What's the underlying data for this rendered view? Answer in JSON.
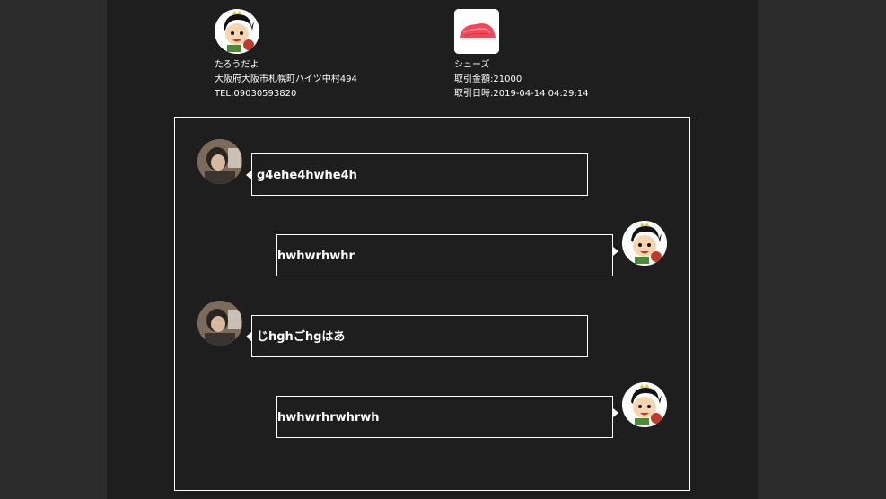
{
  "seller": {
    "name": "たろうだよ",
    "address": "大阪府大阪市札幌町ハイツ中村494",
    "tel": "TEL:09030593820",
    "avatar_icon": "cartoon-boy-avatar-icon"
  },
  "product": {
    "name": "シューズ",
    "price": "取引金額:21000",
    "datetime": "取引日時:2019-04-14 04:29:14",
    "image_icon": "red-shoes-image-icon"
  },
  "messages": [
    {
      "side": "left",
      "text": "g4ehe4hwhe4h",
      "avatar": "photo-avatar-icon"
    },
    {
      "side": "right",
      "text": "hwhwrhwhr",
      "avatar": "cartoon-boy-avatar-icon"
    },
    {
      "side": "left",
      "text": "じhghごhgはあ",
      "avatar": "photo-avatar-icon"
    },
    {
      "side": "right",
      "text": "hwhwrhrwhrwh",
      "avatar": "cartoon-boy-avatar-icon"
    }
  ],
  "colors": {
    "background": "#2b2b2b",
    "panel": "#1e1e1e",
    "border": "#ffffff",
    "text": "#ffffff"
  }
}
